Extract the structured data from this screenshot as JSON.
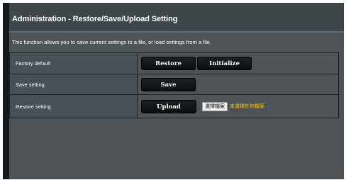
{
  "header": {
    "title": "Administration - Restore/Save/Upload Setting"
  },
  "description": "This function allows you to save current settings to a file, or load settings from a file.",
  "rows": [
    {
      "label": "Factory default"
    },
    {
      "label": "Save setting"
    },
    {
      "label": "Restore setting"
    }
  ],
  "buttons": {
    "restore": "Restore",
    "initialize": "Initialize",
    "save": "Save",
    "upload": "Upload"
  },
  "file_input": {
    "button_label": "選擇檔案",
    "status": "未選擇任何檔案"
  },
  "colors": {
    "panel_bg": "#4d5356",
    "header_bg": "#3f474b",
    "button_bg": "#0f1213",
    "file_status": "#ffc400"
  }
}
